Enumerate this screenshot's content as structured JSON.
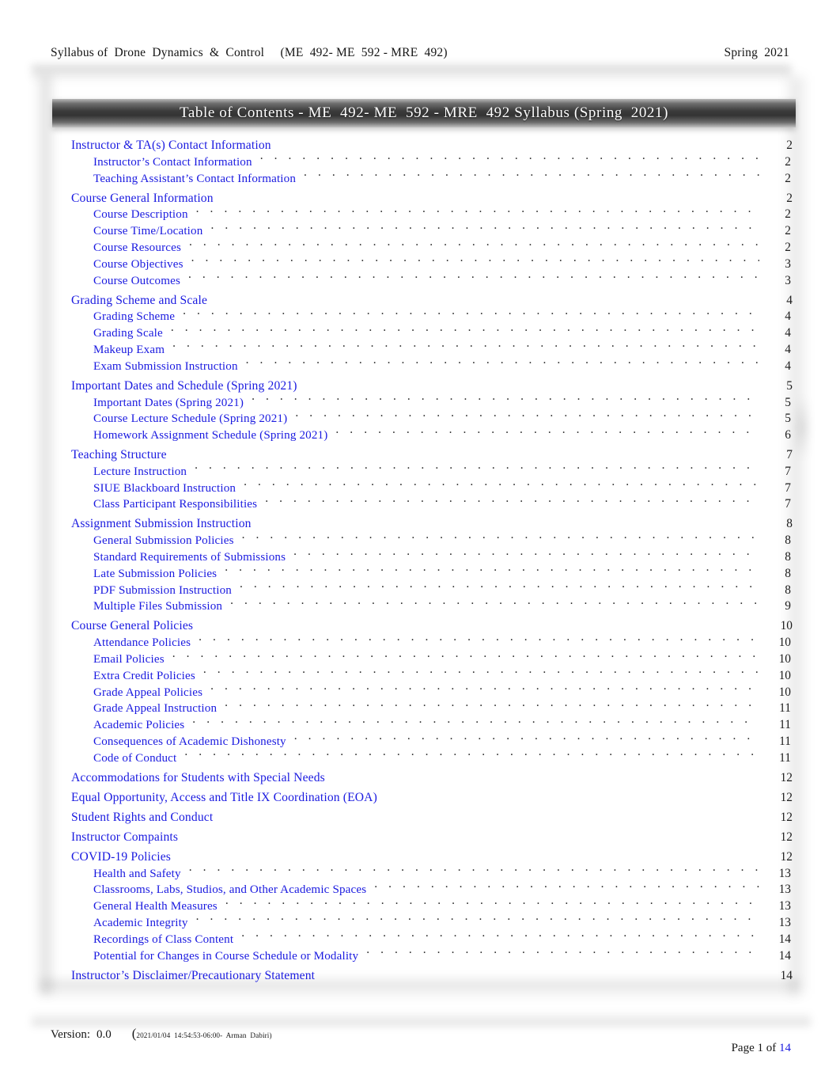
{
  "header": {
    "left": "Syllabus of  Drone  Dynamics  &  Control     (ME  492- ME  592 - MRE  492)",
    "right": "Spring  2021"
  },
  "toc": {
    "title": "Table of Contents - ME  492- ME  592 - MRE  492 Syllabus (Spring  2021)",
    "leader_dots": ". . . . . . . . . . . . . . . . . . . . . . . . . . . . . . . . . . . . . . . . . . . . . . . . . . . . . . . . . . . . . . . . . . . . . . . . . . . . . . . . . . . . . . . . .",
    "entries": [
      {
        "level": 1,
        "label": "Instructor & TA(s) Contact Information",
        "page": "2",
        "group_start": false
      },
      {
        "level": 2,
        "label": "Instructor’s Contact Information",
        "page": "2",
        "group_start": false
      },
      {
        "level": 2,
        "label": "Teaching Assistant’s Contact Information",
        "page": "2",
        "group_start": false
      },
      {
        "level": 1,
        "label": "Course General Information",
        "page": "2",
        "group_start": true
      },
      {
        "level": 2,
        "label": "Course Description",
        "page": "2",
        "group_start": false
      },
      {
        "level": 2,
        "label": "Course Time/Location",
        "page": "2",
        "group_start": false
      },
      {
        "level": 2,
        "label": "Course Resources",
        "page": "2",
        "group_start": false
      },
      {
        "level": 2,
        "label": "Course Objectives",
        "page": "3",
        "group_start": false
      },
      {
        "level": 2,
        "label": "Course Outcomes",
        "page": "3",
        "group_start": false
      },
      {
        "level": 1,
        "label": "Grading Scheme and Scale",
        "page": "4",
        "group_start": true
      },
      {
        "level": 2,
        "label": "Grading Scheme",
        "page": "4",
        "group_start": false
      },
      {
        "level": 2,
        "label": "Grading Scale",
        "page": "4",
        "group_start": false
      },
      {
        "level": 2,
        "label": "Makeup Exam",
        "page": "4",
        "group_start": false
      },
      {
        "level": 2,
        "label": "Exam Submission Instruction",
        "page": "4",
        "group_start": false
      },
      {
        "level": 1,
        "label": "Important Dates and Schedule (Spring  2021)",
        "page": "5",
        "group_start": true
      },
      {
        "level": 2,
        "label": "Important Dates (Spring  2021)",
        "page": "5",
        "group_start": false
      },
      {
        "level": 2,
        "label": "Course Lecture Schedule (Spring  2021)",
        "page": "5",
        "group_start": false
      },
      {
        "level": 2,
        "label": "Homework Assignment Schedule (Spring  2021)",
        "page": "6",
        "group_start": false
      },
      {
        "level": 1,
        "label": "Teaching Structure",
        "page": "7",
        "group_start": true
      },
      {
        "level": 2,
        "label": "Lecture Instruction",
        "page": "7",
        "group_start": false
      },
      {
        "level": 2,
        "label": "SIUE Blackboard Instruction",
        "page": "7",
        "group_start": false
      },
      {
        "level": 2,
        "label": "Class Participant Responsibilities",
        "page": "7",
        "group_start": false
      },
      {
        "level": 1,
        "label": "Assignment Submission Instruction",
        "page": "8",
        "group_start": true
      },
      {
        "level": 2,
        "label": "General Submission Policies",
        "page": "8",
        "group_start": false
      },
      {
        "level": 2,
        "label": "Standard Requirements of Submissions",
        "page": "8",
        "group_start": false
      },
      {
        "level": 2,
        "label": "Late Submission Policies",
        "page": "8",
        "group_start": false
      },
      {
        "level": 2,
        "label": "PDF Submission Instruction",
        "page": "8",
        "group_start": false
      },
      {
        "level": 2,
        "label": "Multiple Files Submission",
        "page": "9",
        "group_start": false
      },
      {
        "level": 1,
        "label": "Course General Policies",
        "page": "10",
        "group_start": true
      },
      {
        "level": 2,
        "label": "Attendance Policies",
        "page": "10",
        "group_start": false
      },
      {
        "level": 2,
        "label": "Email Policies",
        "page": "10",
        "group_start": false
      },
      {
        "level": 2,
        "label": "Extra Credit Policies",
        "page": "10",
        "group_start": false
      },
      {
        "level": 2,
        "label": "Grade Appeal Policies",
        "page": "10",
        "group_start": false
      },
      {
        "level": 2,
        "label": "Grade Appeal Instruction",
        "page": "11",
        "group_start": false
      },
      {
        "level": 2,
        "label": "Academic Policies",
        "page": "11",
        "group_start": false
      },
      {
        "level": 2,
        "label": "Consequences of Academic Dishonesty",
        "page": "11",
        "group_start": false
      },
      {
        "level": 2,
        "label": "Code of Conduct",
        "page": "11",
        "group_start": false
      },
      {
        "level": 1,
        "label": "Accommodations for Students with Special Needs",
        "page": "12",
        "group_start": true
      },
      {
        "level": 1,
        "label": "Equal Opportunity, Access and Title IX Coordination (EOA)",
        "page": "12",
        "group_start": true
      },
      {
        "level": 1,
        "label": "Student Rights and Conduct",
        "page": "12",
        "group_start": true
      },
      {
        "level": 1,
        "label": "Instructor Compaints",
        "page": "12",
        "group_start": true
      },
      {
        "level": 1,
        "label": "COVID-19 Policies",
        "page": "12",
        "group_start": true
      },
      {
        "level": 2,
        "label": "Health and Safety",
        "page": "13",
        "group_start": false
      },
      {
        "level": 2,
        "label": "Classrooms, Labs, Studios, and Other Academic Spaces",
        "page": "13",
        "group_start": false
      },
      {
        "level": 2,
        "label": "General Health Measures",
        "page": "13",
        "group_start": false
      },
      {
        "level": 2,
        "label": "Academic Integrity",
        "page": "13",
        "group_start": false
      },
      {
        "level": 2,
        "label": "Recordings of Class Content",
        "page": "14",
        "group_start": false
      },
      {
        "level": 2,
        "label": "Potential for Changes in Course Schedule or Modality",
        "page": "14",
        "group_start": false
      },
      {
        "level": 1,
        "label": "Instructor’s Disclaimer/Precautionary Statement",
        "page": "14",
        "group_start": true
      }
    ]
  },
  "footer": {
    "version_label": "Version:",
    "version_value": "0.0",
    "stamp_open": "(",
    "stamp": "2021/01/04  14:54:53-06:00-  Arman  Dabiri)",
    "page_prefix": "Page 1 of ",
    "page_total": "14"
  },
  "colors": {
    "link_blue": "#1a1ae0",
    "title_bar_dark": "#343434",
    "body_text": "#151515"
  }
}
